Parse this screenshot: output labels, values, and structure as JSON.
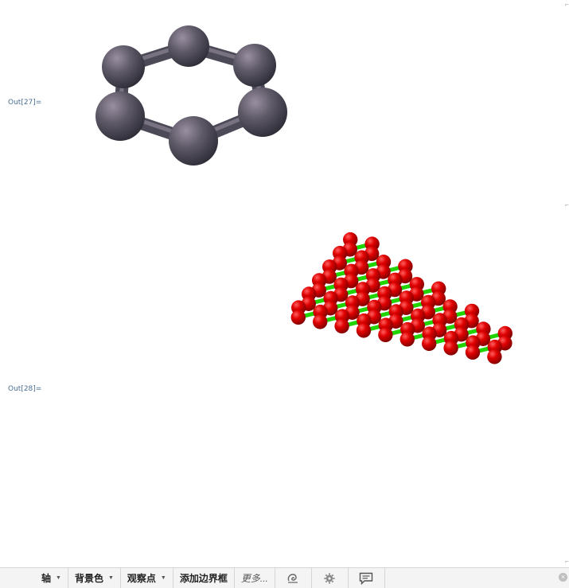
{
  "cells": [
    {
      "label": "Out[27]="
    },
    {
      "label": "Out[28]="
    }
  ],
  "toolbar": {
    "items": [
      {
        "label": "轴",
        "has_menu": true
      },
      {
        "label": "背景色",
        "has_menu": true
      },
      {
        "label": "观察点",
        "has_menu": true
      },
      {
        "label": "添加边界框",
        "has_menu": false
      },
      {
        "label": "更多...",
        "has_menu": false
      }
    ],
    "icons": [
      "swirl-icon",
      "gear-icon",
      "comment-icon",
      "close-icon"
    ]
  },
  "colors": {
    "benzene_atom": "#5f5a68",
    "graphene_atom": "#e00000",
    "graphene_bond": "#22dd00",
    "label": "#4a6f96"
  }
}
